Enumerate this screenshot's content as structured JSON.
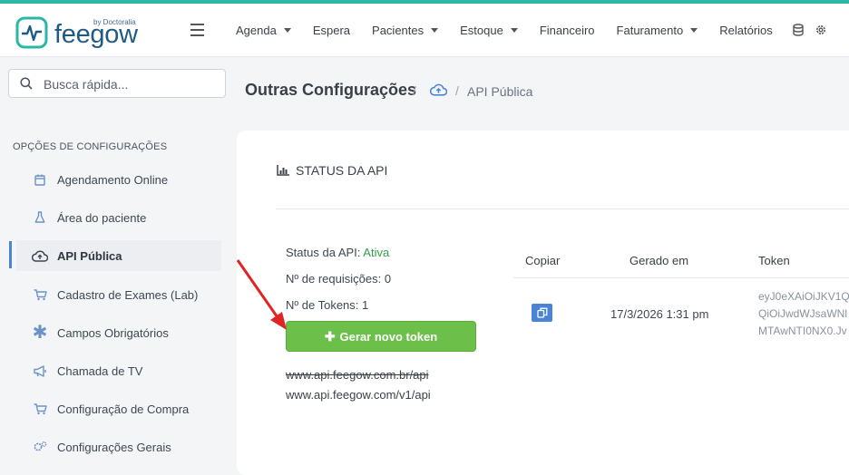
{
  "brand": {
    "name": "feegow",
    "sub": "by Doctoralia"
  },
  "nav": [
    {
      "label": "Agenda",
      "dropdown": true
    },
    {
      "label": "Espera",
      "dropdown": false
    },
    {
      "label": "Pacientes",
      "dropdown": true
    },
    {
      "label": "Estoque",
      "dropdown": true
    },
    {
      "label": "Financeiro",
      "dropdown": false
    },
    {
      "label": "Faturamento",
      "dropdown": true
    },
    {
      "label": "Relatórios",
      "dropdown": false
    }
  ],
  "search": {
    "placeholder": "Busca rápida..."
  },
  "sidebar": {
    "heading": "OPÇÕES DE CONFIGURAÇÕES",
    "items": [
      {
        "label": "Agendamento Online",
        "icon": "calendar-icon"
      },
      {
        "label": "Área do paciente",
        "icon": "flask-icon"
      },
      {
        "label": "API Pública",
        "icon": "cloud-upload-icon"
      },
      {
        "label": "Cadastro de Exames (Lab)",
        "icon": "cart-icon"
      },
      {
        "label": "Campos Obrigatórios",
        "icon": "asterisk-icon"
      },
      {
        "label": "Chamada de TV",
        "icon": "megaphone-icon"
      },
      {
        "label": "Configuração de Compra",
        "icon": "cart-icon"
      },
      {
        "label": "Configurações Gerais",
        "icon": "gears-icon"
      }
    ],
    "active_index": 2
  },
  "breadcrumb": {
    "title": "Outras Configurações",
    "sep": "/",
    "current": "API Pública"
  },
  "card": {
    "title": "STATUS DA API",
    "status_label": "Status da API:",
    "status_value": "Ativa",
    "requests_label": "Nº de requisições:",
    "requests_value": "0",
    "tokens_label": "Nº de Tokens:",
    "tokens_value": "1",
    "generate_button": "Gerar novo token",
    "url_old": "www.api.feegow.com.br/api",
    "url_new": "www.api.feegow.com/v1/api"
  },
  "table": {
    "headers": [
      "Copiar",
      "Gerado em",
      "Token"
    ],
    "rows": [
      {
        "generated": "17/3/2026 1:31 pm",
        "token_lines": [
          "eyJ0eXAiOiJKV1Q",
          "QiOiJwdWJsaWNl",
          "MTAwNTI0NX0.Jv"
        ]
      }
    ]
  },
  "colors": {
    "accent": "#4b84d6",
    "success": "#6cc04a",
    "brand": "#2bb7a7"
  }
}
